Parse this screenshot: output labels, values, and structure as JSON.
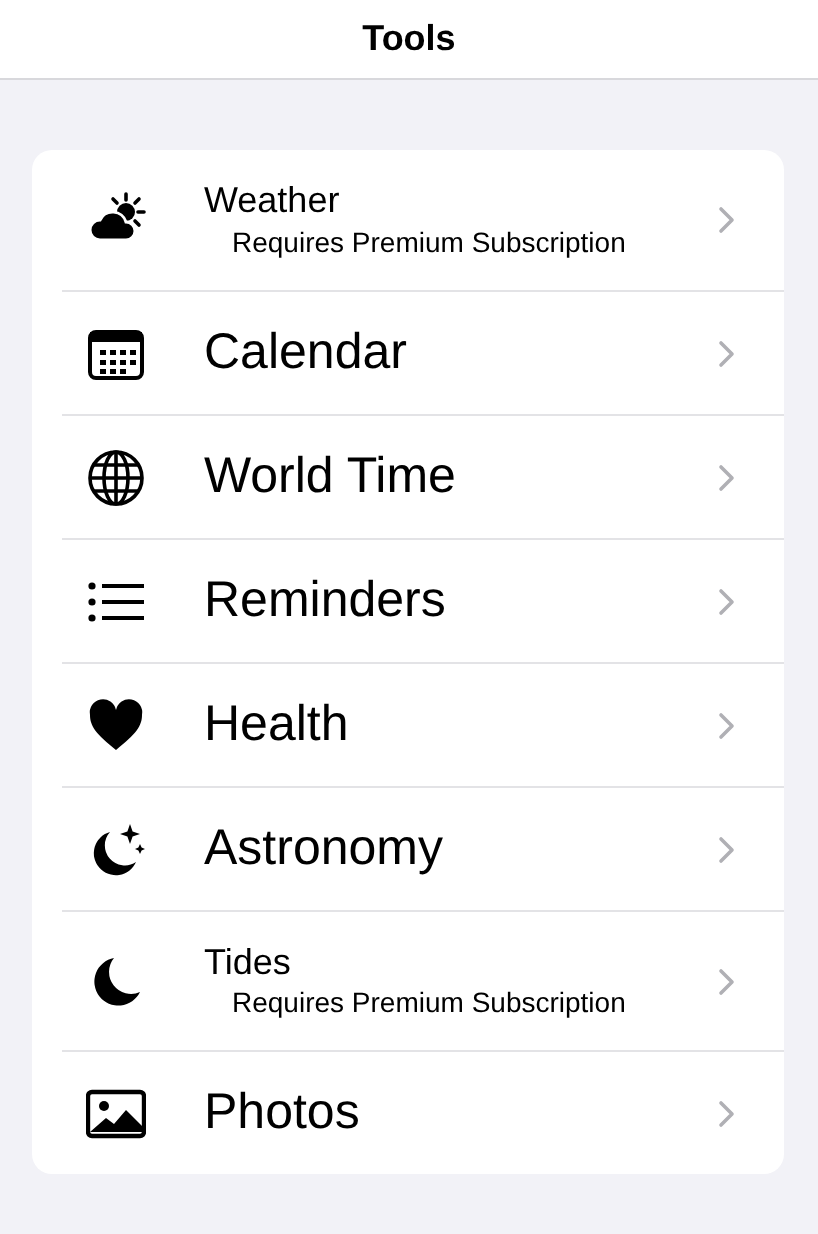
{
  "header": {
    "title": "Tools"
  },
  "items": [
    {
      "label": "Weather",
      "subtitle": "Requires Premium Subscription"
    },
    {
      "label": "Calendar"
    },
    {
      "label": "World Time"
    },
    {
      "label": "Reminders"
    },
    {
      "label": "Health"
    },
    {
      "label": "Astronomy"
    },
    {
      "label": "Tides",
      "subtitle": "Requires Premium Subscription"
    },
    {
      "label": "Photos"
    }
  ]
}
